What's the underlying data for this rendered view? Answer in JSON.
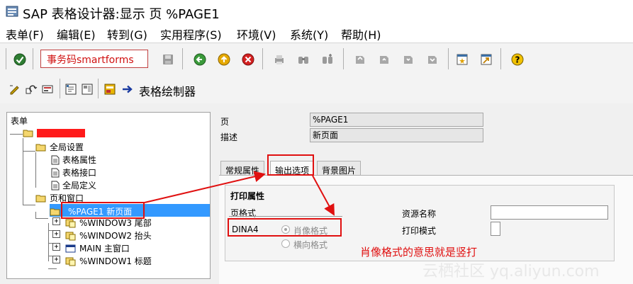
{
  "window": {
    "title": "SAP 表格设计器:显示 页 %PAGE1"
  },
  "menu": {
    "items": [
      "表单(F)",
      "编辑(E)",
      "转到(G)",
      "实用程序(S)",
      "环境(V)",
      "系统(Y)",
      "帮助(H)"
    ]
  },
  "toolbar": {
    "command_value": "事务码smartforms",
    "icons": [
      "check-icon",
      "save-icon",
      "back-icon",
      "exit-icon",
      "cancel-icon",
      "print-icon",
      "find-icon",
      "find-next-icon",
      "first-page-icon",
      "prev-page-icon",
      "next-page-icon",
      "last-page-icon",
      "new-session-icon",
      "shortcut-icon",
      "help-icon"
    ]
  },
  "app_toolbar": {
    "title": "表格绘制器",
    "icons": [
      "edit-icon",
      "other-object-icon",
      "display-icon",
      "field-list-icon",
      "layout-icon",
      "form-painter-icon",
      "arrow-right-icon"
    ]
  },
  "tree": {
    "header": "表单",
    "root_label": "",
    "global_settings": "全局设置",
    "form_attributes": "表格属性",
    "form_interface": "表格接口",
    "global_definitions": "全局定义",
    "pages_windows": "页和窗口",
    "page1": "%PAGE1 新页面",
    "window3": "%WINDOW3 尾部",
    "window2": "%WINDOW2 抬头",
    "main": "MAIN 主窗口",
    "window1": "%WINDOW1 标题"
  },
  "detail": {
    "page_label": "页",
    "page_value": "%PAGE1",
    "desc_label": "描述",
    "desc_value": "新页面",
    "tabs": [
      "常规属性",
      "输出选项",
      "背景图片"
    ],
    "group_title": "打印属性",
    "page_format_label": "页格式",
    "page_format_value": "DINA4",
    "portrait_label": "肖像格式",
    "landscape_label": "横向格式",
    "resource_name_label": "资源名称",
    "print_mode_label": "打印模式"
  },
  "annotation": "肖像格式的意思就是竖打",
  "watermark": "云栖社区 yq.aliyun.com",
  "colors": {
    "annotation_red": "#e01010",
    "selection_blue": "#3399ff"
  }
}
